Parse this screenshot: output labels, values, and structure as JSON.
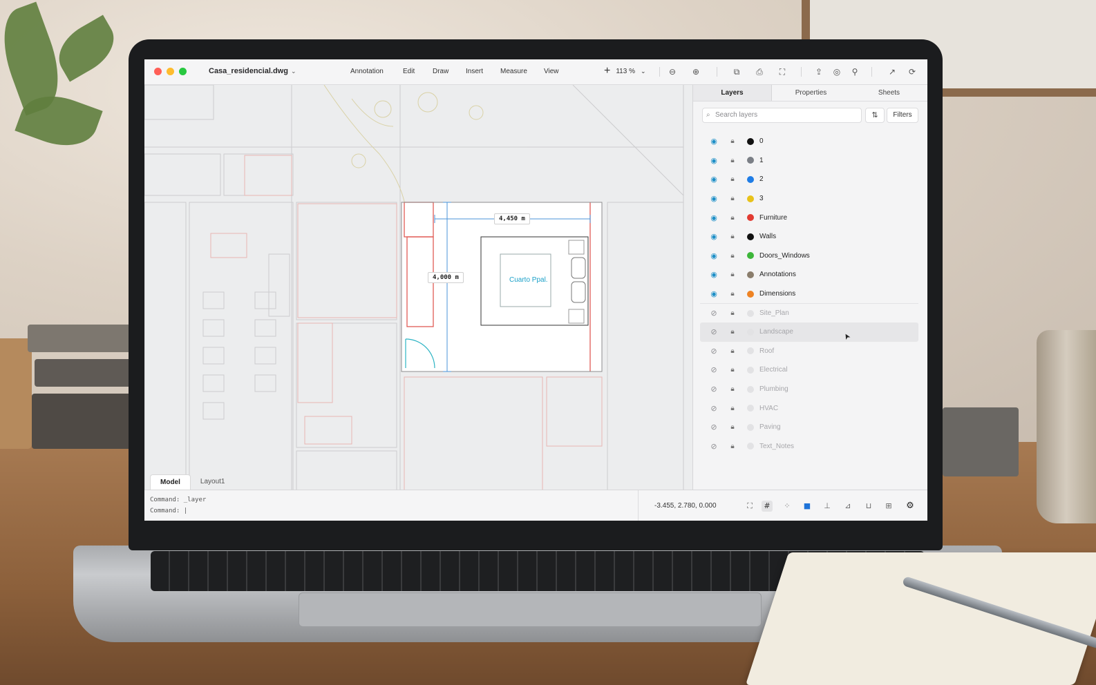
{
  "app": {
    "document_title": "Casa_residencial.dwg",
    "menu": [
      "Annotation",
      "Edit",
      "Draw",
      "Insert",
      "Measure",
      "View"
    ],
    "zoom_level": "113 %",
    "toolbar_icons": [
      "zoom-out-icon",
      "zoom-in-icon",
      "export-icon",
      "print-icon",
      "fit-icon",
      "share-icon",
      "target-icon",
      "person-icon",
      "open-external-icon",
      "sync-icon"
    ]
  },
  "canvas": {
    "dim_horizontal": "4,450 m",
    "dim_vertical": "4,000 m",
    "room_label": "Cuarto Ppal.",
    "tabs": [
      "Model",
      "Layout1"
    ]
  },
  "panel": {
    "tabs": [
      "Layers",
      "Properties",
      "Sheets"
    ],
    "search_placeholder": "Search layers",
    "filters_label": "Filters",
    "layers": [
      {
        "name": "0",
        "color": "#111111",
        "visible": true
      },
      {
        "name": "1",
        "color": "#7b7f86",
        "visible": true
      },
      {
        "name": "2",
        "color": "#1f7de6",
        "visible": true
      },
      {
        "name": "3",
        "color": "#e8c21a",
        "visible": true
      },
      {
        "name": "Furniture",
        "color": "#e23b32",
        "visible": true
      },
      {
        "name": "Walls",
        "color": "#111111",
        "visible": true
      },
      {
        "name": "Doors_Windows",
        "color": "#3db63a",
        "visible": true
      },
      {
        "name": "Annotations",
        "color": "#8a7d6c",
        "visible": true
      },
      {
        "name": "Dimensions",
        "color": "#ee8324",
        "visible": true
      },
      {
        "name": "Site_Plan",
        "color": "#e2e2e4",
        "visible": false
      },
      {
        "name": "Landscape",
        "color": "#e2e2e4",
        "visible": false
      },
      {
        "name": "Roof",
        "color": "#e2e2e4",
        "visible": false
      },
      {
        "name": "Electrical",
        "color": "#e2e2e4",
        "visible": false
      },
      {
        "name": "Plumbing",
        "color": "#e2e2e4",
        "visible": false
      },
      {
        "name": "HVAC",
        "color": "#e2e2e4",
        "visible": false
      },
      {
        "name": "Paving",
        "color": "#e2e2e4",
        "visible": false
      },
      {
        "name": "Text_Notes",
        "color": "#e2e2e4",
        "visible": false
      }
    ]
  },
  "statusbar": {
    "command_1": "Command: _layer",
    "command_2": "Command: |",
    "coordinates": "-3.455, 2.780, 0.000"
  }
}
